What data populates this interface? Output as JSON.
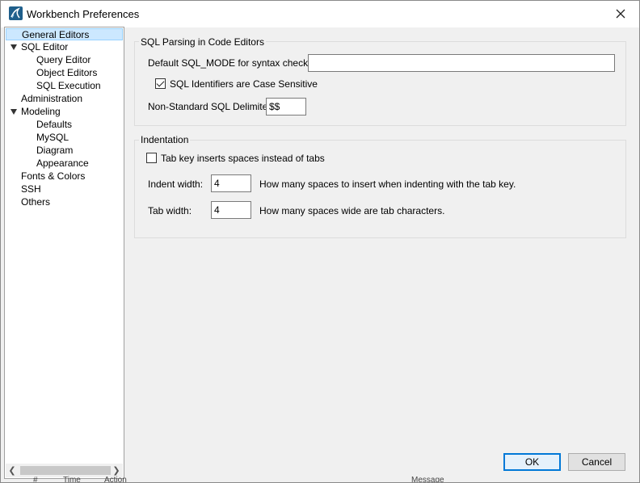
{
  "window": {
    "title": "Workbench Preferences"
  },
  "sidebar": {
    "items": [
      {
        "label": "General Editors"
      },
      {
        "label": "SQL Editor"
      },
      {
        "label": "Query Editor"
      },
      {
        "label": "Object Editors"
      },
      {
        "label": "SQL Execution"
      },
      {
        "label": "Administration"
      },
      {
        "label": "Modeling"
      },
      {
        "label": "Defaults"
      },
      {
        "label": "MySQL"
      },
      {
        "label": "Diagram"
      },
      {
        "label": "Appearance"
      },
      {
        "label": "Fonts & Colors"
      },
      {
        "label": "SSH"
      },
      {
        "label": "Others"
      }
    ]
  },
  "sql_parsing": {
    "title": "SQL Parsing in Code Editors",
    "sql_mode_label": "Default SQL_MODE for syntax checker:",
    "sql_mode_value": "",
    "case_sensitive_label": "SQL Identifiers are Case Sensitive",
    "case_sensitive_checked": true,
    "delimiter_label": "Non-Standard SQL Delimiter:",
    "delimiter_value": "$$"
  },
  "indentation": {
    "title": "Indentation",
    "tab_spaces_label": "Tab key inserts spaces instead of tabs",
    "tab_spaces_checked": false,
    "indent_width_label": "Indent width:",
    "indent_width_value": "4",
    "indent_width_hint": "How many spaces to insert when indenting with the tab key.",
    "tab_width_label": "Tab width:",
    "tab_width_value": "4",
    "tab_width_hint": "How many spaces wide are tab characters."
  },
  "buttons": {
    "ok": "OK",
    "cancel": "Cancel"
  },
  "background": {
    "col1": "#",
    "col2": "Time",
    "col3": "Action",
    "col4": "Message"
  },
  "colors": {
    "selection_bg": "#cce8ff",
    "default_button_border": "#0078d7"
  }
}
